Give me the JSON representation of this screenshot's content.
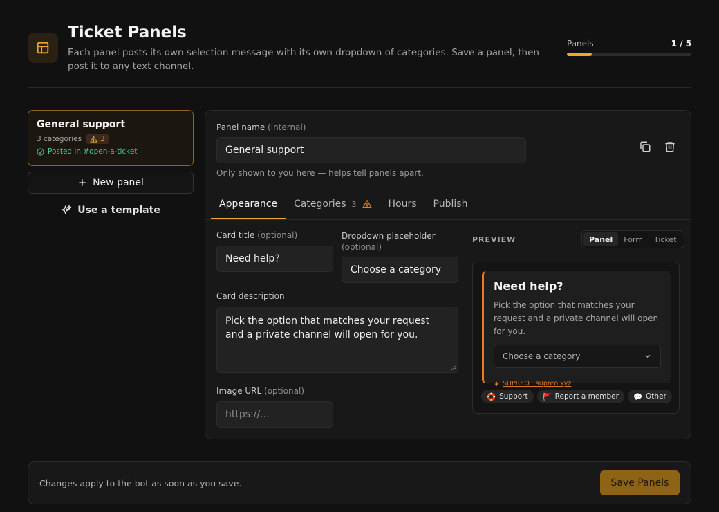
{
  "header": {
    "title": "Ticket Panels",
    "subtitle": "Each panel posts its own selection message with its own dropdown of categories. Save a panel, then post it to any text channel.",
    "counter_label": "Panels",
    "counter_value": "1 / 5",
    "counter_progress": 0.2,
    "accent_color": "#f0a630"
  },
  "sidebar": {
    "panels": [
      {
        "title": "General support",
        "categories_text": "3 categories",
        "warning_count": "3",
        "posted_text": "Posted in #open-a-ticket",
        "selected": true
      }
    ],
    "new_panel_label": "New panel",
    "use_template_label": "Use a template"
  },
  "editor": {
    "panel_name": {
      "label": "Panel name",
      "label_note": "(internal)",
      "value": "General support",
      "help": "Only shown to you here — helps tell panels apart."
    },
    "tabs": [
      {
        "label": "Appearance",
        "active": true
      },
      {
        "label": "Categories",
        "count": "3",
        "warning": true
      },
      {
        "label": "Hours"
      },
      {
        "label": "Publish"
      }
    ],
    "card_title": {
      "label": "Card title",
      "note": "(optional)",
      "value": "Need help?"
    },
    "dropdown_placeholder": {
      "label": "Dropdown placeholder",
      "note": "(optional)",
      "value": "Choose a category"
    },
    "card_description": {
      "label": "Card description",
      "value": "Pick the option that matches your request and a private channel will open for you."
    },
    "image_url": {
      "label": "Image URL",
      "note": "(optional)",
      "placeholder": "https://..."
    }
  },
  "preview": {
    "label": "PREVIEW",
    "modes": [
      "Panel",
      "Form",
      "Ticket"
    ],
    "active_mode": "Panel",
    "card": {
      "title": "Need help?",
      "description": "Pick the option that matches your request and a private channel will open for you.",
      "select_placeholder": "Choose a category",
      "brand": "SUPREO · supreo.xyz",
      "border_color": "#f07a1a"
    },
    "chips": [
      {
        "icon": "lifebuoy-icon",
        "glyph": "🛟",
        "label": "Support"
      },
      {
        "icon": "red-flag-icon",
        "glyph": "🚩",
        "label": "Report a member"
      },
      {
        "icon": "speech-bubble-icon",
        "glyph": "💬",
        "label": "Other"
      }
    ]
  },
  "footer": {
    "text": "Changes apply to the bot as soon as you save.",
    "save_label": "Save Panels"
  }
}
